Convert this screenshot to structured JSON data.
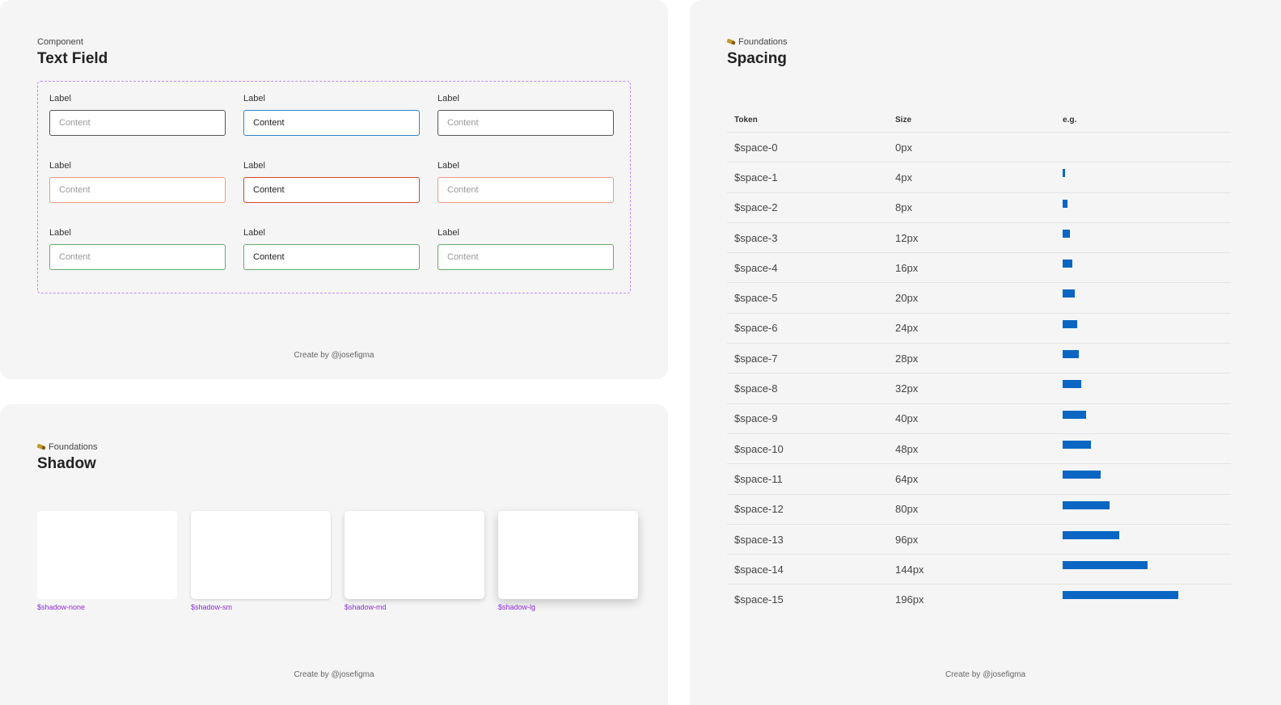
{
  "text_field_panel": {
    "eyebrow": "Component",
    "title": "Text Field",
    "footer": "Create by @josefigma",
    "fields": [
      {
        "label": "Label",
        "value": "",
        "placeholder": "Content",
        "state": "default"
      },
      {
        "label": "Label",
        "value": "Content",
        "placeholder": "Content",
        "state": "focused"
      },
      {
        "label": "Label",
        "value": "",
        "placeholder": "Content",
        "state": "default"
      },
      {
        "label": "Label",
        "value": "",
        "placeholder": "Content",
        "state": "error"
      },
      {
        "label": "Label",
        "value": "Content",
        "placeholder": "Content",
        "state": "error"
      },
      {
        "label": "Label",
        "value": "",
        "placeholder": "Content",
        "state": "error"
      },
      {
        "label": "Label",
        "value": "",
        "placeholder": "Content",
        "state": "success"
      },
      {
        "label": "Label",
        "value": "Content",
        "placeholder": "Content",
        "state": "success"
      },
      {
        "label": "Label",
        "value": "",
        "placeholder": "Content",
        "state": "success"
      }
    ]
  },
  "shadow_panel": {
    "eyebrow_icon": "pencil-icon",
    "eyebrow": "Foundations",
    "title": "Shadow",
    "footer": "Create by @josefigma",
    "cards": [
      {
        "label": "$shadow-none"
      },
      {
        "label": "$shadow-sm"
      },
      {
        "label": "$shadow-md"
      },
      {
        "label": "$shadow-lg"
      }
    ]
  },
  "spacing_panel": {
    "eyebrow_icon": "pencil-icon",
    "eyebrow": "Foundations",
    "title": "Spacing",
    "footer": "Create by @josefigma",
    "headers": {
      "token": "Token",
      "size": "Size",
      "eg": "e.g."
    },
    "rows": [
      {
        "token": "$space-0",
        "size": "0px",
        "value": 0
      },
      {
        "token": "$space-1",
        "size": "4px",
        "value": 4
      },
      {
        "token": "$space-2",
        "size": "8px",
        "value": 8
      },
      {
        "token": "$space-3",
        "size": "12px",
        "value": 12
      },
      {
        "token": "$space-4",
        "size": "16px",
        "value": 16
      },
      {
        "token": "$space-5",
        "size": "20px",
        "value": 20
      },
      {
        "token": "$space-6",
        "size": "24px",
        "value": 24
      },
      {
        "token": "$space-7",
        "size": "28px",
        "value": 28
      },
      {
        "token": "$space-8",
        "size": "32px",
        "value": 32
      },
      {
        "token": "$space-9",
        "size": "40px",
        "value": 40
      },
      {
        "token": "$space-10",
        "size": "48px",
        "value": 48
      },
      {
        "token": "$space-11",
        "size": "64px",
        "value": 64
      },
      {
        "token": "$space-12",
        "size": "80px",
        "value": 80
      },
      {
        "token": "$space-13",
        "size": "96px",
        "value": 96
      },
      {
        "token": "$space-14",
        "size": "144px",
        "value": 144
      },
      {
        "token": "$space-15",
        "size": "196px",
        "value": 196
      }
    ]
  },
  "colors": {
    "panel_bg": "#f5f5f5",
    "focus": "#2f83d1",
    "error": "#d9432b",
    "error_light": "#ee9a84",
    "success": "#64a870",
    "accent_purple": "#8a2bd8",
    "bar": "#0a66c2"
  }
}
